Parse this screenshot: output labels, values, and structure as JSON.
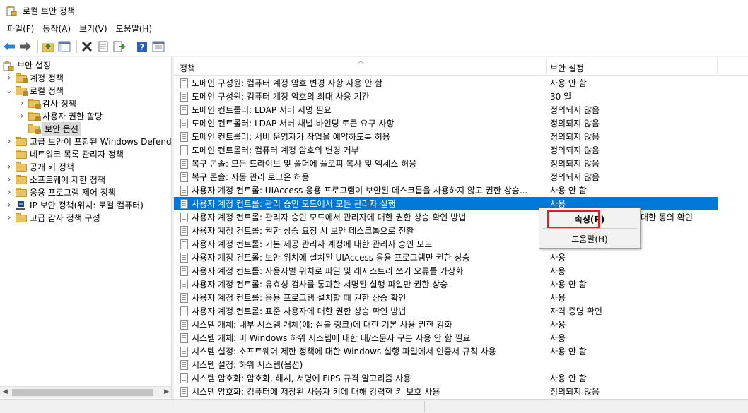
{
  "window": {
    "title": "로컬 보안 정책"
  },
  "menu": [
    "파일(F)",
    "동작(A)",
    "보기(V)",
    "도움말(H)"
  ],
  "toolbar": {
    "icons": [
      "back-arrow-icon",
      "forward-arrow-icon",
      "up-folder-icon",
      "show-tree-icon",
      "delete-icon",
      "properties-icon",
      "export-icon",
      "help-icon",
      "view-icon"
    ]
  },
  "tree": [
    {
      "label": "보안 설정",
      "level": 0,
      "expanded": true
    },
    {
      "label": "계정 정책",
      "level": 1,
      "expanded": false
    },
    {
      "label": "로컬 정책",
      "level": 1,
      "expanded": true
    },
    {
      "label": "감사 정책",
      "level": 2,
      "expanded": false
    },
    {
      "label": "사용자 권한 할당",
      "level": 2,
      "expanded": false
    },
    {
      "label": "보안 옵션",
      "level": 2,
      "selected": true
    },
    {
      "label": "고급 보안이 포함된 Windows Defender 방화벽",
      "level": 1,
      "expanded": false
    },
    {
      "label": "네트워크 목록 관리자 정책",
      "level": 1
    },
    {
      "label": "공개 키 정책",
      "level": 1,
      "expanded": false
    },
    {
      "label": "소프트웨어 제한 정책",
      "level": 1,
      "expanded": false
    },
    {
      "label": "응용 프로그램 제어 정책",
      "level": 1,
      "expanded": false
    },
    {
      "label": "IP 보안 정책(위치: 로컬 컴퓨터)",
      "level": 1,
      "expanded": false,
      "icon": "ip-security-icon"
    },
    {
      "label": "고급 감사 정책 구성",
      "level": 1,
      "expanded": false
    }
  ],
  "list": {
    "columns": {
      "policy": "정책",
      "setting": "보안 설정"
    },
    "rows": [
      {
        "policy": "도메인 구성원: 컴퓨터 계정 암호 변경 사항 사용 안 함",
        "setting": "사용 안 함"
      },
      {
        "policy": "도메인 구성원: 컴퓨터 계정 암호의 최대 사용 기간",
        "setting": "30 일"
      },
      {
        "policy": "도메인 컨트롤러: LDAP 서버 서명 필요",
        "setting": "정의되지 않음"
      },
      {
        "policy": "도메인 컨트롤러: LDAP 서버 채널 바인딩 토큰 요구 사항",
        "setting": "정의되지 않음"
      },
      {
        "policy": "도메인 컨트롤러: 서버 운영자가 작업을 예약하도록 허용",
        "setting": "정의되지 않음"
      },
      {
        "policy": "도메인 컨트롤러: 컴퓨터 계정 암호의 변경 거부",
        "setting": "정의되지 않음"
      },
      {
        "policy": "복구 콘솔: 모든 드라이브 및 폴더에 플로피 복사 및 액세스 허용",
        "setting": "정의되지 않음"
      },
      {
        "policy": "복구 콘솔: 자동 관리 로그온 허용",
        "setting": "정의되지 않음"
      },
      {
        "policy": "사용자 계정 컨트롤: UIAccess 응용 프로그램이 보안된 데스크톱을 사용하지 않고 권한 상승...",
        "setting": "사용 안 함"
      },
      {
        "policy": "사용자 계정 컨트롤: 관리 승인 모드에서 모든 관리자 실행",
        "setting": "사용",
        "selected": true
      },
      {
        "policy": "사용자 계정 컨트롤: 관리자 승인 모드에서 관리자에 대한 권한 상승 확인 방법",
        "setting": ""
      },
      {
        "policy": "사용자 계정 컨트롤: 권한 상승 요청 시 보안 데스크톱으로 전환",
        "setting": ""
      },
      {
        "policy": "사용자 계정 컨트롤: 기본 제공 관리자 계정에 대한 관리자 승인 모드",
        "setting": ""
      },
      {
        "policy": "사용자 계정 컨트롤: 보안 위치에 설치된 UIAccess 응용 프로그램만 권한 상승",
        "setting": "사용"
      },
      {
        "policy": "사용자 계정 컨트롤: 사용자별 위치로 파일 및 레지스트리 쓰기 오류를 가상화",
        "setting": "사용"
      },
      {
        "policy": "사용자 계정 컨트롤: 유효성 검사를 통과한 서명된 실행 파일만 권한 상승",
        "setting": "사용 안 함"
      },
      {
        "policy": "사용자 계정 컨트롤: 응용 프로그램 설치할 때 권한 상승 확인",
        "setting": "사용"
      },
      {
        "policy": "사용자 계정 컨트롤: 표준 사용자에 대한 권한 상승 확인 방법",
        "setting": "자격 증명 확인"
      },
      {
        "policy": "시스템 개체: 내부 시스템 개체(예: 심볼 링크)에 대한 기본 사용 권한 강화",
        "setting": "사용"
      },
      {
        "policy": "시스템 개체: 비 Windows 하위 시스템에 대한 대/소문자 구분 사용 안 함 필요",
        "setting": "사용"
      },
      {
        "policy": "시스템 설정: 소프트웨어 제한 정책에 대한 Windows 실행 파일에서 인증서 규칙 사용",
        "setting": "사용 안 함"
      },
      {
        "policy": "시스템 설정: 하위 시스템(옵션)",
        "setting": ""
      },
      {
        "policy": "시스템 암호화: 암호화, 해시, 서명에 FIPS 규격 알고리즘 사용",
        "setting": "사용 안 함"
      },
      {
        "policy": "시스템 암호화: 컴퓨터에 저장된 사용자 키에 대해 강력한 키 보호 사용",
        "setting": "정의되지 않음"
      }
    ],
    "covered_text": "대한 동의 확인"
  },
  "context_menu": {
    "items": [
      "속성(R)",
      "도움말(H)"
    ],
    "highlight_color": "#e02020"
  },
  "colors": {
    "selection": "#0078d7",
    "folder": "#e8c266"
  }
}
